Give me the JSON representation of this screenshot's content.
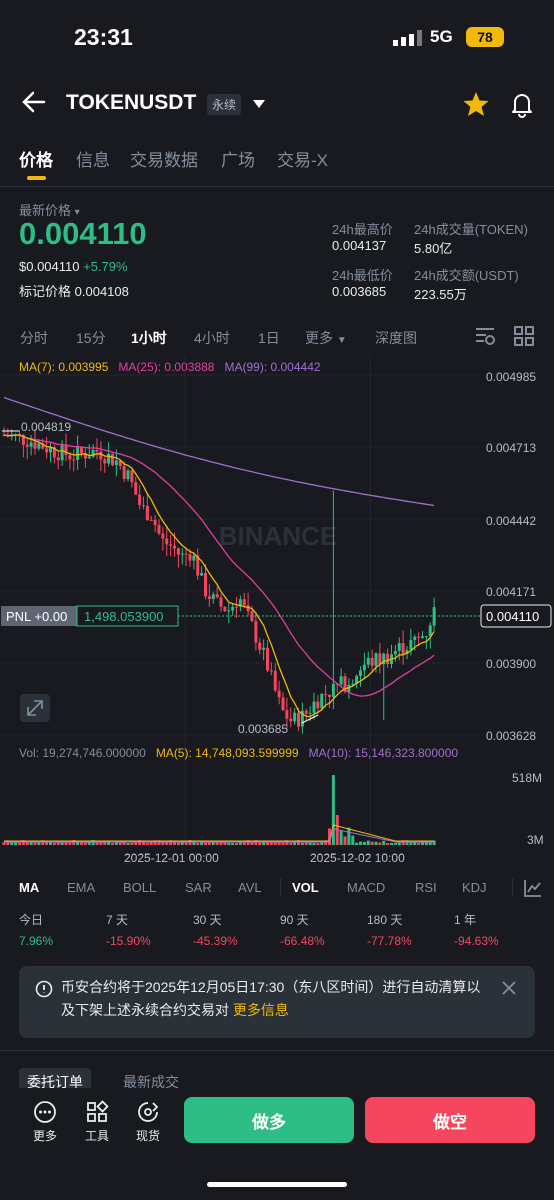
{
  "status_bar": {
    "time": "23:31",
    "network": "5G",
    "battery": "78"
  },
  "header": {
    "symbol": "TOKENUSDT",
    "contract_type": "永续"
  },
  "tabs": [
    "价格",
    "信息",
    "交易数据",
    "广场",
    "交易-X"
  ],
  "price": {
    "label": "最新价格",
    "last": "0.004110",
    "usd": "$0.004110",
    "change": "+5.79%",
    "mark_label": "标记价格",
    "mark": "0.004108"
  },
  "stats": {
    "high_label": "24h最高价",
    "high": "0.004137",
    "vol_token_label": "24h成交量(TOKEN)",
    "vol_token": "5.80亿",
    "low_label": "24h最低价",
    "low": "0.003685",
    "vol_usdt_label": "24h成交额(USDT)",
    "vol_usdt": "223.55万"
  },
  "intervals": [
    "分时",
    "15分",
    "1小时",
    "4小时",
    "1日",
    "更多",
    "深度图"
  ],
  "ma_legend": {
    "ma7": "MA(7): 0.003995",
    "ma25": "MA(25): 0.003888",
    "ma99": "MA(99): 0.004442"
  },
  "chart_data": {
    "type": "candlestick",
    "price_axis": [
      "0.004985",
      "0.004713",
      "0.004442",
      "0.004171",
      "0.003900",
      "0.003628"
    ],
    "x_labels": [
      "2025-12-01 00:00",
      "2025-12-02 10:00"
    ],
    "annotations": {
      "high": "0.004819",
      "low": "0.003685"
    },
    "watermark": "BINANCE",
    "current_price": "0.004110",
    "pnl_label": "PNL +0.00",
    "position_price": "1,498.053900",
    "colors": {
      "up": "#2ebd85",
      "down": "#f6465d",
      "ma7": "#f0b90b",
      "ma25": "#e040a0",
      "ma99": "#a070d0"
    },
    "volume_axis": [
      "518M",
      "3M"
    ]
  },
  "vol_legend": {
    "vol": "Vol: 19,274,746.000000",
    "ma5": "MA(5): 14,748,093.599999",
    "ma10": "MA(10): 15,146,323.800000"
  },
  "indicators": [
    "MA",
    "EMA",
    "BOLL",
    "SAR",
    "AVL",
    "VOL",
    "MACD",
    "RSI",
    "KDJ"
  ],
  "performance": [
    {
      "label": "今日",
      "value": "7.96%"
    },
    {
      "label": "7 天",
      "value": "-15.90%"
    },
    {
      "label": "30 天",
      "value": "-45.39%"
    },
    {
      "label": "90 天",
      "value": "-66.48%"
    },
    {
      "label": "180 天",
      "value": "-77.78%"
    },
    {
      "label": "1 年",
      "value": "-94.63%"
    }
  ],
  "notice": {
    "text": "币安合约将于2025年12月05日17:30（东八区时间）进行自动清算以及下架上述永续合约交易对",
    "link": "更多信息"
  },
  "order_tabs": [
    "委托订单",
    "最新成交"
  ],
  "bottom": {
    "more": "更多",
    "tools": "工具",
    "spot": "现货",
    "long": "做多",
    "short": "做空"
  }
}
